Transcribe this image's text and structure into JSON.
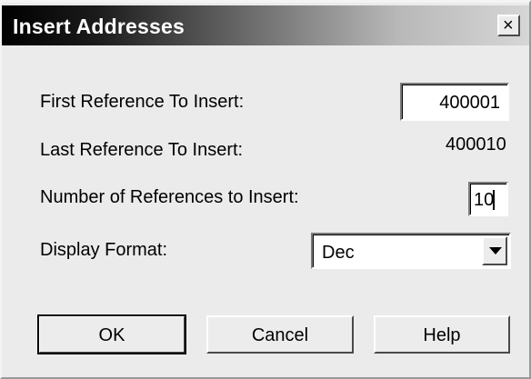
{
  "window": {
    "title": "Insert Addresses",
    "close_glyph": "×"
  },
  "form": {
    "first_reference_label": "First Reference To Insert:",
    "first_reference_value": "400001",
    "last_reference_label": "Last Reference To Insert:",
    "last_reference_value": "400010",
    "number_of_references_label": "Number of References to Insert:",
    "number_of_references_value": "10",
    "display_format_label": "Display Format:",
    "display_format_selected": "Dec"
  },
  "buttons": {
    "ok": "OK",
    "cancel": "Cancel",
    "help": "Help"
  },
  "icons": {
    "close": "close-icon",
    "dropdown": "chevron-down-icon"
  }
}
